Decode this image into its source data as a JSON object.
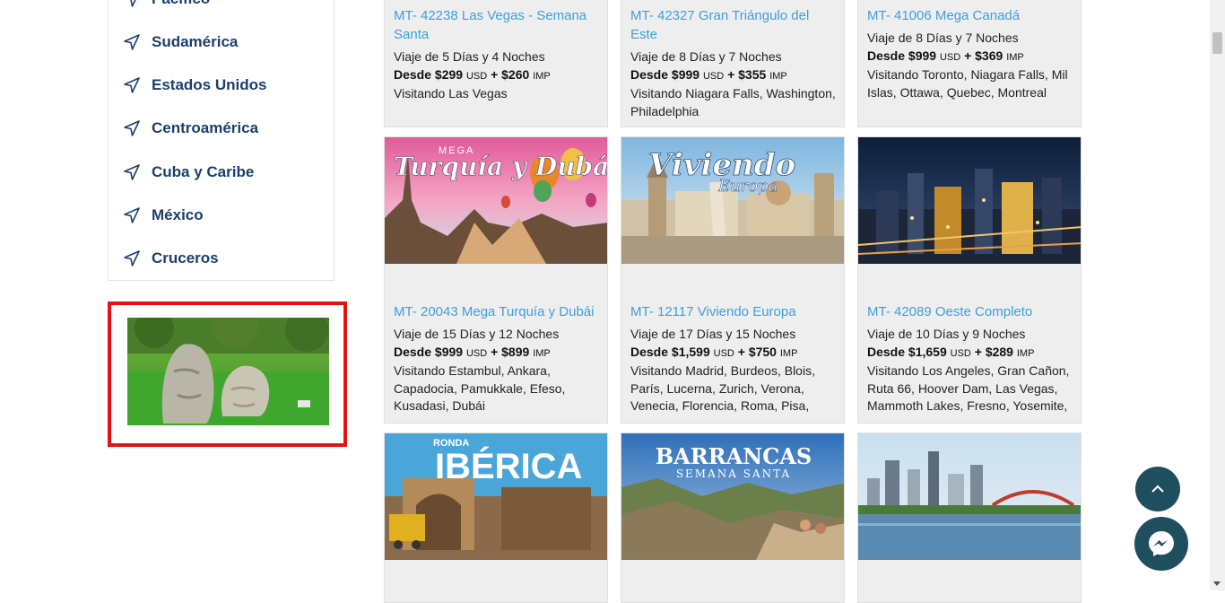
{
  "sidebar": {
    "items": [
      {
        "label": "Pacífico"
      },
      {
        "label": "Sudamérica"
      },
      {
        "label": "Estados Unidos"
      },
      {
        "label": "Centroamérica"
      },
      {
        "label": "Cuba y Caribe"
      },
      {
        "label": "México"
      },
      {
        "label": "Cruceros"
      }
    ]
  },
  "promo": {
    "image_icon": "olmec-heads-photo"
  },
  "cards": [
    {
      "title": "MT- 42238 Las Vegas - Semana Santa",
      "duration": "Viaje de 5 Días y 4 Noches",
      "price_from": "Desde $299",
      "currency": "USD",
      "tax": "+ $260",
      "tax_unit": "IMP",
      "route": "Visitando Las Vegas"
    },
    {
      "title": "MT- 42327 Gran Triángulo del Este",
      "duration": "Viaje de 8 Días y 7 Noches",
      "price_from": "Desde $999",
      "currency": "USD",
      "tax": "+ $355",
      "tax_unit": "IMP",
      "route": "Visitando Niagara Falls, Washington, Philadelphia"
    },
    {
      "title": "MT- 41006 Mega Canadá",
      "duration": "Viaje de 8 Días y 7 Noches",
      "price_from": "Desde $999",
      "currency": "USD",
      "tax": "+ $369",
      "tax_unit": "IMP",
      "route": "Visitando Toronto, Niagara Falls, Mil Islas, Ottawa, Quebec, Montreal"
    },
    {
      "title": "MT- 20043 Mega Turquía y Dubái",
      "image_text_1": "MEGA",
      "image_text_2": "Turquía y Dubái",
      "duration": "Viaje de 15 Días y 12 Noches",
      "price_from": "Desde $999",
      "currency": "USD",
      "tax": "+ $899",
      "tax_unit": "IMP",
      "route": "Visitando Estambul, Ankara, Capadocia, Pamukkale, Efeso, Kusadasi, Dubái"
    },
    {
      "title": "MT- 12117 Viviendo Europa",
      "image_text_1": "Viviendo",
      "image_text_2": "Europa",
      "duration": "Viaje de 17 Días y 15 Noches",
      "price_from": "Desde $1,599",
      "currency": "USD",
      "tax": "+ $750",
      "tax_unit": "IMP",
      "route": "Visitando Madrid, Burdeos, Blois, París, Lucerna, Zurich, Verona, Venecia, Florencia, Roma, Pisa,"
    },
    {
      "title": "MT- 42089 Oeste Completo",
      "duration": "Viaje de 10 Días y 9 Noches",
      "price_from": "Desde $1,659",
      "currency": "USD",
      "tax": "+ $289",
      "tax_unit": "IMP",
      "route": "Visitando Los Angeles, Gran Cañon, Ruta 66, Hoover Dam, Las Vegas, Mammoth Lakes, Fresno, Yosemite,"
    },
    {
      "image_text_1": "RONDA",
      "image_text_2": "IBÉRICA"
    },
    {
      "image_text_1": "BARRANCAS",
      "image_text_2": "SEMANA SANTA"
    },
    {}
  ],
  "colors": {
    "accent_blue": "#3aa0dd",
    "nav_blue": "#1d3f6c",
    "highlight_red": "#e8110f",
    "fab": "#1f4f5f"
  }
}
